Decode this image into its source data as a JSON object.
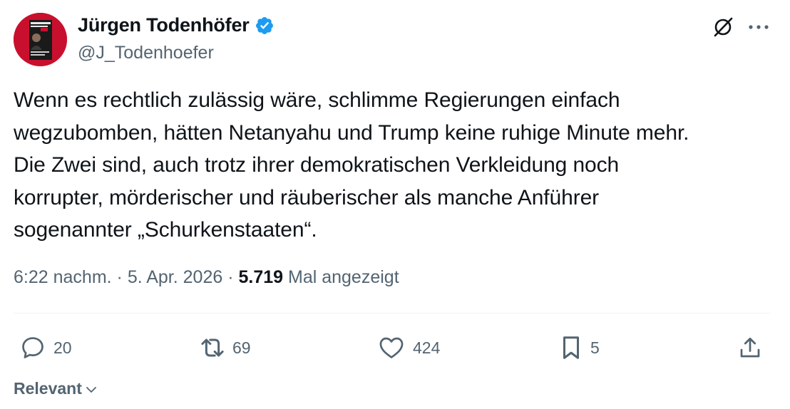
{
  "author": {
    "display_name": "Jürgen Todenhöfer",
    "handle": "@J_Todenhoefer",
    "verified": true,
    "avatar_icon": "book-cover-avatar"
  },
  "header_actions": {
    "grok_icon": "grok-icon",
    "more_icon": "more-icon"
  },
  "tweet": {
    "text": "Wenn es rechtlich zulässig wäre, schlimme Regierungen einfach\nwegzubomben, hätten Netanyahu und Trump keine ruhige Minute mehr.\nDie Zwei sind, auch trotz ihrer demokratischen Verkleidung noch\nkorrupter, mörderischer und räuberischer als manche Anführer\nsogenannter „Schurkenstaaten“.",
    "time": "6:22 nachm.",
    "separator": " · ",
    "date": "5. Apr. 2026",
    "views_count": "5.719",
    "views_label": " Mal angezeigt"
  },
  "actions": {
    "reply": {
      "icon": "reply-icon",
      "count": "20"
    },
    "retweet": {
      "icon": "retweet-icon",
      "count": "69"
    },
    "like": {
      "icon": "heart-icon",
      "count": "424"
    },
    "bookmark": {
      "icon": "bookmark-icon",
      "count": "5"
    },
    "share": {
      "icon": "share-icon"
    }
  },
  "replies_sort": {
    "label": "Relevant",
    "icon": "chevron-down-icon"
  },
  "colors": {
    "text_primary": "#0f1419",
    "text_secondary": "#536471",
    "verified_blue": "#1d9bf0",
    "divider": "#eff3f4",
    "avatar_red": "#c8102e"
  }
}
